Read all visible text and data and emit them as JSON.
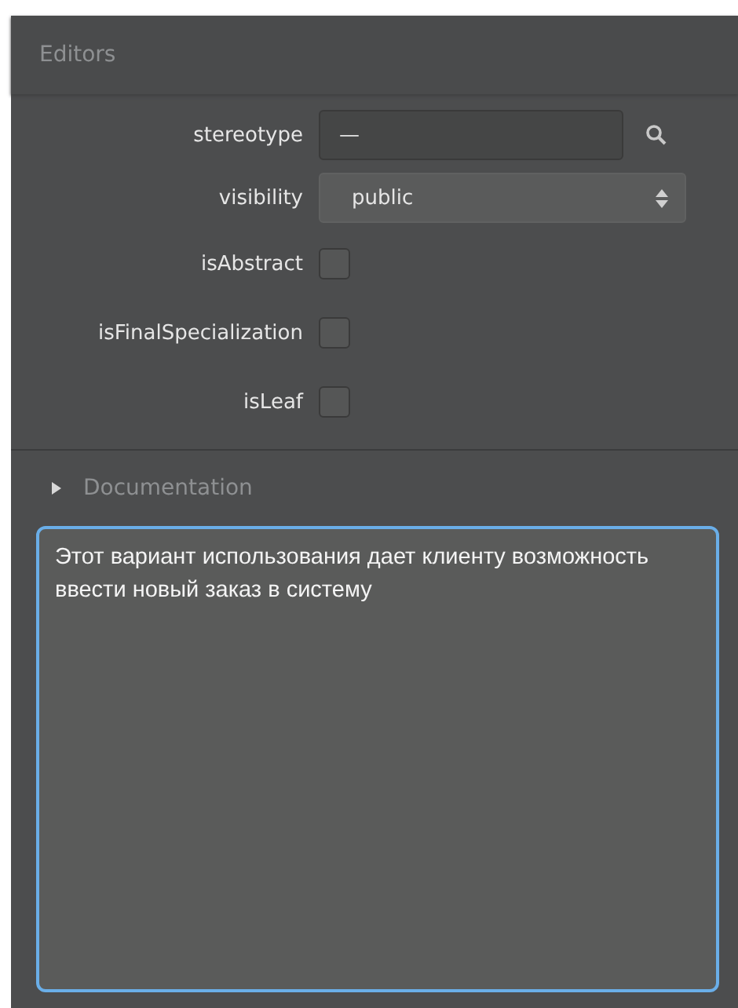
{
  "panel": {
    "title": "Editors"
  },
  "stereotype": {
    "label": "stereotype",
    "value": "—"
  },
  "visibility": {
    "label": "visibility",
    "value": "public"
  },
  "flags": [
    {
      "label": "isAbstract",
      "checked": false
    },
    {
      "label": "isFinalSpecialization",
      "checked": false
    },
    {
      "label": "isLeaf",
      "checked": false
    }
  ],
  "documentation": {
    "label": "Documentation",
    "expanded": false,
    "value": "Этот вариант использования дает клиенту возможность ввести новый заказ в систему"
  }
}
